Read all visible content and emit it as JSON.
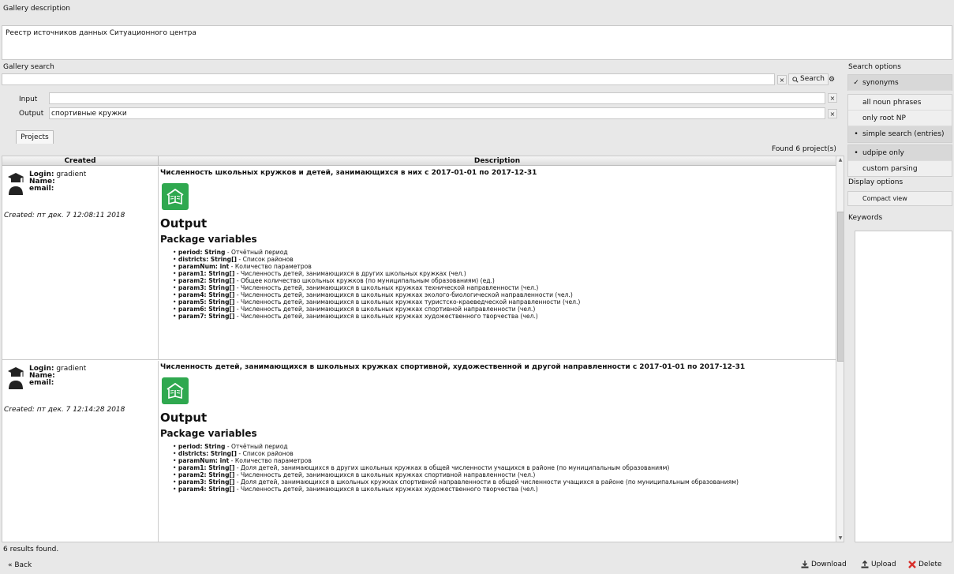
{
  "gallery_description": {
    "label": "Gallery description",
    "text": "Реестр источников данных Ситуационного центра"
  },
  "gallery_search": {
    "label": "Gallery search",
    "query": "",
    "clear_label": "×",
    "search_label": "Search"
  },
  "input_field": {
    "label": "Input",
    "value": ""
  },
  "output_field": {
    "label": "Output",
    "value": "спортивные кружки"
  },
  "tabs": [
    {
      "label": "Projects"
    }
  ],
  "found_label": "Found 6 project(s)",
  "table": {
    "col_created": "Created",
    "col_description": "Description",
    "rows": [
      {
        "login_label": "Login:",
        "login": "gradient",
        "name_label": "Name:",
        "email_label": "email:",
        "created": "Created: пт дек. 7 12:08:11 2018",
        "title": "Численность школьных кружков и детей, занимающихся в них с 2017-01-01 по 2017-12-31",
        "output_heading": "Output",
        "package_heading": "Package variables",
        "variables": [
          {
            "name": "period: String",
            "desc": " - Отчётный период"
          },
          {
            "name": "districts: String[]",
            "desc": " - Список районов"
          },
          {
            "name": "paramNum: int",
            "desc": " - Количество параметров"
          },
          {
            "name": "param1: String[]",
            "desc": " - Численность детей, занимающихся в других школьных кружках (чел.)"
          },
          {
            "name": "param2: String[]",
            "desc": " - Общее количество школьных кружков (по муниципальным образованиям) (ед.)"
          },
          {
            "name": "param3: String[]",
            "desc": " - Численность детей, занимающихся в школьных кружках технической направленности (чел.)"
          },
          {
            "name": "param4: String[]",
            "desc": " - Численность детей, занимающихся в школьных кружках эколого-биологической направленности (чел.)"
          },
          {
            "name": "param5: String[]",
            "desc": " - Численность детей, занимающихся в школьных кружках туристско-краеведческой направленности (чел.)"
          },
          {
            "name": "param6: String[]",
            "desc": " - Численность детей, занимающихся в школьных кружках спортивной направленности (чел.)"
          },
          {
            "name": "param7: String[]",
            "desc": " - Численность детей, занимающихся в школьных кружках художественного творчества (чел.)"
          }
        ]
      },
      {
        "login_label": "Login:",
        "login": "gradient",
        "name_label": "Name:",
        "email_label": "email:",
        "created": "Created: пт дек. 7 12:14:28 2018",
        "title": "Численность детей, занимающихся в школьных кружках спортивной, художественной и другой направленности с 2017-01-01 по 2017-12-31",
        "output_heading": "Output",
        "package_heading": "Package variables",
        "variables": [
          {
            "name": "period: String",
            "desc": " - Отчётный период"
          },
          {
            "name": "districts: String[]",
            "desc": " - Список районов"
          },
          {
            "name": "paramNum: int",
            "desc": " - Количество параметров"
          },
          {
            "name": "param1: String[]",
            "desc": " - Доля детей, занимающихся в других школьных кружках в общей численности учащихся в районе (по муниципальным образованиям)"
          },
          {
            "name": "param2: String[]",
            "desc": " - Численность детей, занимающихся в школьных кружках спортивной направленности (чел.)"
          },
          {
            "name": "param3: String[]",
            "desc": " - Доля детей, занимающихся в школьных кружках спортивной направленности в общей численности учащихся в районе (по муниципальным образованиям)"
          },
          {
            "name": "param4: String[]",
            "desc": " - Численность детей, занимающихся в школьных кружках художественного творчества (чел.)"
          }
        ]
      }
    ]
  },
  "results_label": "6 results found.",
  "back_label": "« Back",
  "actions": {
    "download": "Download",
    "upload": "Upload",
    "delete": "Delete"
  },
  "search_options": {
    "label": "Search options",
    "synonyms": "synonyms",
    "synonyms_checked": true,
    "parse_modes": [
      "all noun phrases",
      "only root NP",
      "simple search (entries)"
    ],
    "parse_selected": "simple search (entries)",
    "parser_modes": [
      "udpipe only",
      "custom parsing"
    ],
    "parser_selected": "udpipe only"
  },
  "display_options": {
    "label": "Display options",
    "compact_view": "Compact view",
    "compact_checked": false
  },
  "keywords": {
    "label": "Keywords"
  },
  "colors": {
    "accent_green": "#2fa84f",
    "delete_red": "#d9302c",
    "upload_green": "#2e7d32"
  }
}
